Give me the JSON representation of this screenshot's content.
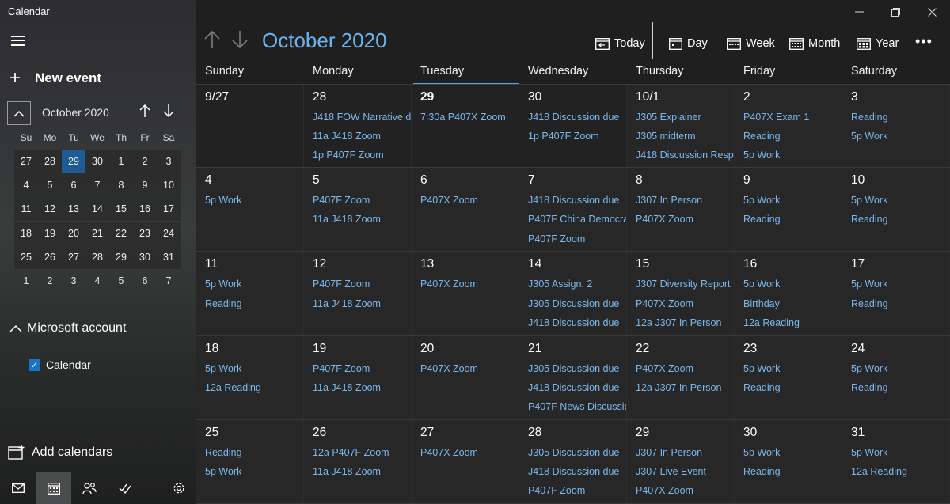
{
  "app": {
    "title": "Calendar"
  },
  "sidebar": {
    "new_event": "New event",
    "mini": {
      "month": "October 2020",
      "days_of_week": [
        "Su",
        "Mo",
        "Tu",
        "We",
        "Th",
        "Fr",
        "Sa"
      ],
      "weeks": [
        [
          "27",
          "28",
          "29",
          "30",
          "1",
          "2",
          "3"
        ],
        [
          "4",
          "5",
          "6",
          "7",
          "8",
          "9",
          "10"
        ],
        [
          "11",
          "12",
          "13",
          "14",
          "15",
          "16",
          "17"
        ],
        [
          "18",
          "19",
          "20",
          "21",
          "22",
          "23",
          "24"
        ],
        [
          "25",
          "26",
          "27",
          "28",
          "29",
          "30",
          "31"
        ],
        [
          "1",
          "2",
          "3",
          "4",
          "5",
          "6",
          "7"
        ]
      ]
    },
    "account": "Microsoft account",
    "calendar_item": "Calendar",
    "add_calendars": "Add calendars"
  },
  "header": {
    "month": "October 2020",
    "views": {
      "today": "Today",
      "day": "Day",
      "week": "Week",
      "month": "Month",
      "year": "Year"
    },
    "more": "•••"
  },
  "colors": {
    "accent": "#6bb3ee",
    "today_cell": "#1f5a92",
    "event_text": "#7cb8ee"
  },
  "days_of_week": [
    "Sunday",
    "Monday",
    "Tuesday",
    "Wednesday",
    "Thursday",
    "Friday",
    "Saturday"
  ],
  "weeks": [
    [
      {
        "date": "9/27",
        "events": []
      },
      {
        "date": "28",
        "events": [
          "J418 FOW Narrative d",
          "11a J418 Zoom",
          "1p P407F Zoom"
        ]
      },
      {
        "date": "29",
        "events": [
          "7:30a P407X Zoom"
        ]
      },
      {
        "date": "30",
        "events": [
          "J418 Discussion due",
          "1p P407F Zoom"
        ]
      },
      {
        "date": "10/1",
        "events": [
          "J305 Explainer",
          "J305 midterm",
          "J418 Discussion Respo"
        ]
      },
      {
        "date": "2",
        "events": [
          "P407X Exam 1",
          "Reading",
          "5p Work"
        ]
      },
      {
        "date": "3",
        "events": [
          "Reading",
          "5p Work"
        ]
      }
    ],
    [
      {
        "date": "4",
        "events": [
          "5p Work"
        ]
      },
      {
        "date": "5",
        "events": [
          "P407F Zoom",
          "11a J418 Zoom"
        ]
      },
      {
        "date": "6",
        "events": [
          "P407X Zoom"
        ]
      },
      {
        "date": "7",
        "events": [
          "J418 Discussion due",
          "P407F China Democra",
          "P407F Zoom"
        ]
      },
      {
        "date": "8",
        "events": [
          "J307 In Person",
          "P407X Zoom"
        ]
      },
      {
        "date": "9",
        "events": [
          "5p Work",
          "Reading"
        ]
      },
      {
        "date": "10",
        "events": [
          "5p Work",
          "Reading"
        ]
      }
    ],
    [
      {
        "date": "11",
        "events": [
          "5p Work",
          "Reading"
        ]
      },
      {
        "date": "12",
        "events": [
          "P407F Zoom",
          "11a J418 Zoom"
        ]
      },
      {
        "date": "13",
        "events": [
          "P407X Zoom"
        ]
      },
      {
        "date": "14",
        "events": [
          "J305 Assign. 2",
          "J305 Discussion due",
          "J418 Discussion due"
        ]
      },
      {
        "date": "15",
        "events": [
          "J307 Diversity Report",
          "P407X Zoom",
          "12a J307 In Person"
        ]
      },
      {
        "date": "16",
        "events": [
          "5p Work",
          "Birthday",
          "12a Reading"
        ]
      },
      {
        "date": "17",
        "events": [
          "5p Work",
          "Reading"
        ]
      }
    ],
    [
      {
        "date": "18",
        "events": [
          "5p Work",
          "12a Reading"
        ]
      },
      {
        "date": "19",
        "events": [
          "P407F Zoom",
          "11a J418 Zoom"
        ]
      },
      {
        "date": "20",
        "events": [
          "P407X Zoom"
        ]
      },
      {
        "date": "21",
        "events": [
          "J305 Discussion due",
          "J418 Discussion due",
          "P407F News Discussic"
        ]
      },
      {
        "date": "22",
        "events": [
          "P407X Zoom",
          "12a J307 In Person"
        ]
      },
      {
        "date": "23",
        "events": [
          "5p Work",
          "Reading"
        ]
      },
      {
        "date": "24",
        "events": [
          "5p Work",
          "Reading"
        ]
      }
    ],
    [
      {
        "date": "25",
        "events": [
          "Reading",
          "5p Work"
        ]
      },
      {
        "date": "26",
        "events": [
          "12a P407F Zoom",
          "11a J418 Zoom"
        ]
      },
      {
        "date": "27",
        "events": [
          "P407X Zoom"
        ]
      },
      {
        "date": "28",
        "events": [
          "J305 Discussion due",
          "J418 Discussion due",
          "P407F Zoom"
        ]
      },
      {
        "date": "29",
        "events": [
          "J307 In Person",
          "J307 Live Event",
          "P407X Zoom"
        ]
      },
      {
        "date": "30",
        "events": [
          "5p Work",
          "Reading"
        ]
      },
      {
        "date": "31",
        "events": [
          "5p Work",
          "12a Reading"
        ]
      }
    ]
  ]
}
